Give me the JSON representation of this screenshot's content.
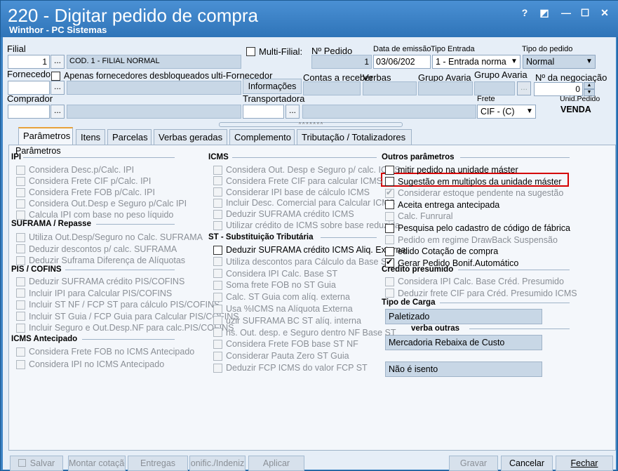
{
  "window": {
    "title": "220 - Digitar pedido de compra",
    "subtitle": "Winthor - PC Sistemas",
    "controls": [
      "?",
      "◩",
      "—",
      "☐",
      "✕"
    ]
  },
  "header": {
    "filial_label": "Filial",
    "filial_code": "1",
    "filial_name": "COD. 1 - FILIAL NORMAL",
    "multi_filial_label": "Multi-Filial:",
    "num_pedido_label": "Nº Pedido",
    "num_pedido_value": "1",
    "data_emissao_label": "Data de emissão",
    "data_emissao_value": "03/06/202",
    "tipo_entrada_label": "Tipo Entrada",
    "tipo_entrada_value": "1 - Entrada norma",
    "tipo_pedido_label": "Tipo do pedido",
    "tipo_pedido_value": "Normal",
    "fornecedor_label": "Fornecedor",
    "apenas_fornecedores_label": "Apenas fornecedores desbloqueados",
    "multi_fornecedor_label": "ulti-Fornecedor",
    "informacoes_button": "Informações",
    "contas_receber_label": "Contas a receber",
    "verbas_label": "Verbas",
    "grupo_avaria_label_1": "Grupo Avaria",
    "grupo_avaria_label_2": "Grupo Avaria",
    "num_negociacao_label": "Nº da negociação",
    "num_negociacao_value": "0",
    "comprador_label": "Comprador",
    "transportadora_label": "Transportadora",
    "frete_label": "Frete",
    "frete_value": "CIF - (C)",
    "unid_pedido_label": "Unid.Pedido",
    "unid_pedido_value": "VENDA",
    "dots": "..."
  },
  "tabs": [
    {
      "label": "Parâmetros",
      "active": true
    },
    {
      "label": "Itens"
    },
    {
      "label": "Parcelas"
    },
    {
      "label": "Verbas geradas"
    },
    {
      "label": "Complemento"
    },
    {
      "label": "Tributação / Totalizadores"
    }
  ],
  "panel_title": "Parâmetros",
  "ipi": {
    "title": "IPI",
    "items": [
      {
        "label": "Considera Desc.p/Calc. IPI",
        "checked": false
      },
      {
        "label": "Considera Frete CIF p/Calc. IPI",
        "checked": false
      },
      {
        "label": "Considera Frete FOB p/Calc. IPI",
        "checked": false
      },
      {
        "label": "Considera Out.Desp e Seguro p/Calc IPI",
        "checked": false
      },
      {
        "label": "Calcula IPI com base no peso líquido",
        "checked": false
      }
    ]
  },
  "suframa": {
    "title": "SUFRAMA / Repasse",
    "items": [
      {
        "label": "Utiliza Out.Desp/Seguro no Calc. SUFRAMA",
        "checked": false
      },
      {
        "label": "Deduzir descontos p/ calc. SUFRAMA",
        "checked": false
      },
      {
        "label": "Deduzir Suframa Diferença de Alíquotas",
        "checked": false
      }
    ]
  },
  "pis": {
    "title": "PIS / COFINS",
    "items": [
      {
        "label": "Deduzir SUFRAMA crédito PIS/COFINS",
        "checked": false
      },
      {
        "label": "Incluir IPI para Calcular PIS/COFINS",
        "checked": false
      },
      {
        "label": "Incluir ST NF / FCP ST para cálculo PIS/COFINS",
        "checked": false
      },
      {
        "label": "Incluir ST Guia / FCP Guia para Calcular PIS/COFINS",
        "checked": false
      },
      {
        "label": "Incluir Seguro e Out.Desp.NF para calc.PIS/COFINS",
        "checked": false
      }
    ]
  },
  "icms_antecipado": {
    "title": "ICMS Antecipado",
    "items": [
      {
        "label": "Considera Frete FOB no ICMS Antecipado",
        "checked": false
      },
      {
        "label": "Considera IPI no ICMS Antecipado",
        "checked": false
      }
    ]
  },
  "icms": {
    "title": "ICMS",
    "items": [
      {
        "label": "Considera Out. Desp e Seguro p/ calc. ICMS",
        "checked": false
      },
      {
        "label": "Considera Frete CIF para calcular ICMS",
        "checked": false
      },
      {
        "label": "Considerar IPI base de cálculo ICMS",
        "checked": false
      },
      {
        "label": "Incluir Desc. Comercial  para Calcular ICMS",
        "checked": false
      },
      {
        "label": "Deduzir SUFRAMA crédito ICMS",
        "checked": false
      },
      {
        "label": "Utilizar crédito de ICMS sobre base reduzida",
        "checked": false
      }
    ]
  },
  "st": {
    "title": "ST - Substituição Tributária",
    "items": [
      {
        "label": "Deduzir SUFRAMA crédito ICMS Aliq. Externa",
        "checked": false,
        "enabled": true
      },
      {
        "label": "Utiliza descontos para Cálculo da Base ST",
        "checked": false
      },
      {
        "label": "Considera IPI Calc. Base ST",
        "checked": false
      },
      {
        "label": "Soma frete FOB no ST Guia",
        "checked": false
      },
      {
        "label": "Calc. ST Guia com alíq. externa",
        "checked": false
      },
      {
        "label": "Usa %ICMS na Alíquota Externa",
        "checked": false
      },
      {
        "label": "uzir SUFRAMA BC ST alíq. interna",
        "checked": false
      },
      {
        "label": "ns. Out. desp. e Seguro dentro NF Base ST",
        "checked": false
      },
      {
        "label": "Considera Frete FOB base ST NF",
        "checked": false
      },
      {
        "label": "Considerar Pauta Zero ST Guia",
        "checked": false
      },
      {
        "label": "Deduzir FCP ICMS do valor FCP ST",
        "checked": false
      }
    ]
  },
  "outros": {
    "title": "Outros parâmetros",
    "items": [
      {
        "label": "mitir pedido na unidade máster",
        "checked": false,
        "enabled": true
      },
      {
        "label": "Sugestão em multiplos da unidade máster",
        "checked": false,
        "enabled": true
      },
      {
        "label": "Considerar estoque pendente na sugestão",
        "checked": true
      },
      {
        "label": "Aceita entrega antecipada",
        "checked": false,
        "enabled": true
      },
      {
        "label": "Calc. Funrural",
        "checked": false
      },
      {
        "label": "Pesquisa pelo cadastro de código de fábrica",
        "checked": false,
        "enabled": true
      },
      {
        "label": "Pedido em regime DrawBack Suspensão",
        "checked": false
      },
      {
        "label": "edido Cotação de compra",
        "checked": false,
        "enabled": true
      },
      {
        "label": "Gerar Pedido Bonif.Automático",
        "checked": true,
        "enabled": true
      }
    ]
  },
  "credito_presumido": {
    "title": "Crédito presumido",
    "items": [
      {
        "label": "Considera IPI Calc. Base Créd. Presumido",
        "checked": false
      },
      {
        "label": "Deduzir frete CIF para Créd. Presumido ICMS",
        "checked": false
      }
    ]
  },
  "tipo_carga": {
    "title": "Tipo de Carga",
    "value": "Paletizado"
  },
  "verba_outras": {
    "title": "verba outras",
    "value": "Mercadoria Rebaixa de Custo"
  },
  "isencao": {
    "value": "Não é isento"
  },
  "buttons": {
    "salvar": "Salvar",
    "montar_cotacao": "Montar cotação",
    "entregas": "Entregas",
    "bonific": "onific./Indeniz",
    "aplicar": "Aplicar",
    "gravar": "Gravar",
    "cancelar": "Cancelar",
    "fechar": "Fechar"
  }
}
